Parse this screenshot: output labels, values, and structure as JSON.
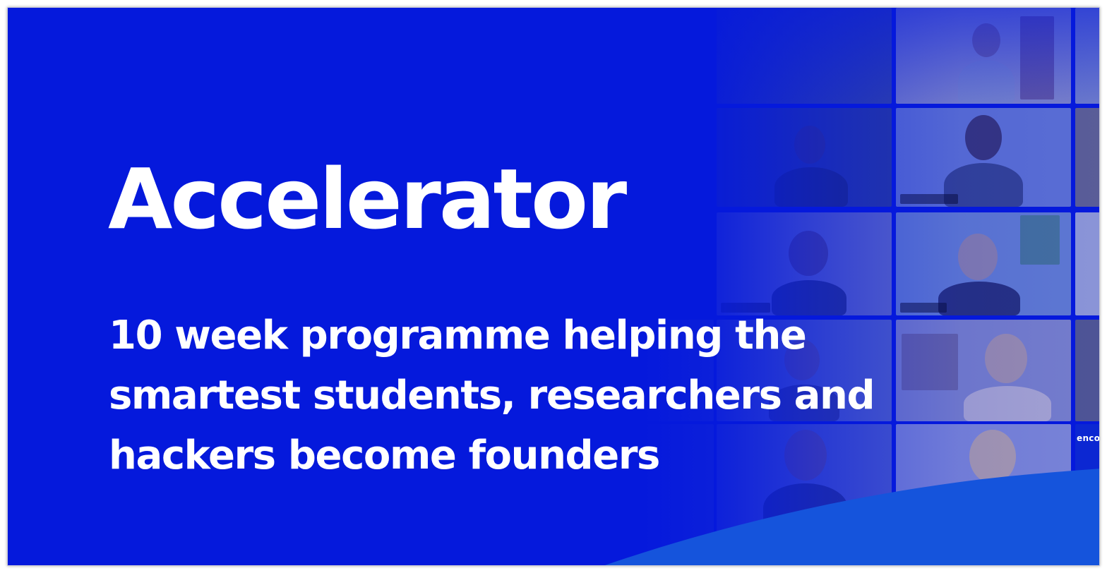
{
  "banner": {
    "title": "Accelerator",
    "tagline": "10 week programme helping the smartest students, researchers and hackers become founders",
    "side_label": "enco"
  },
  "background": {
    "type": "video-call-participant-grid",
    "participant_count_visible": 12
  },
  "colors": {
    "background_blue": "#0519DC",
    "wave_blue": "#1554DC",
    "text": "#FFFFFF"
  }
}
